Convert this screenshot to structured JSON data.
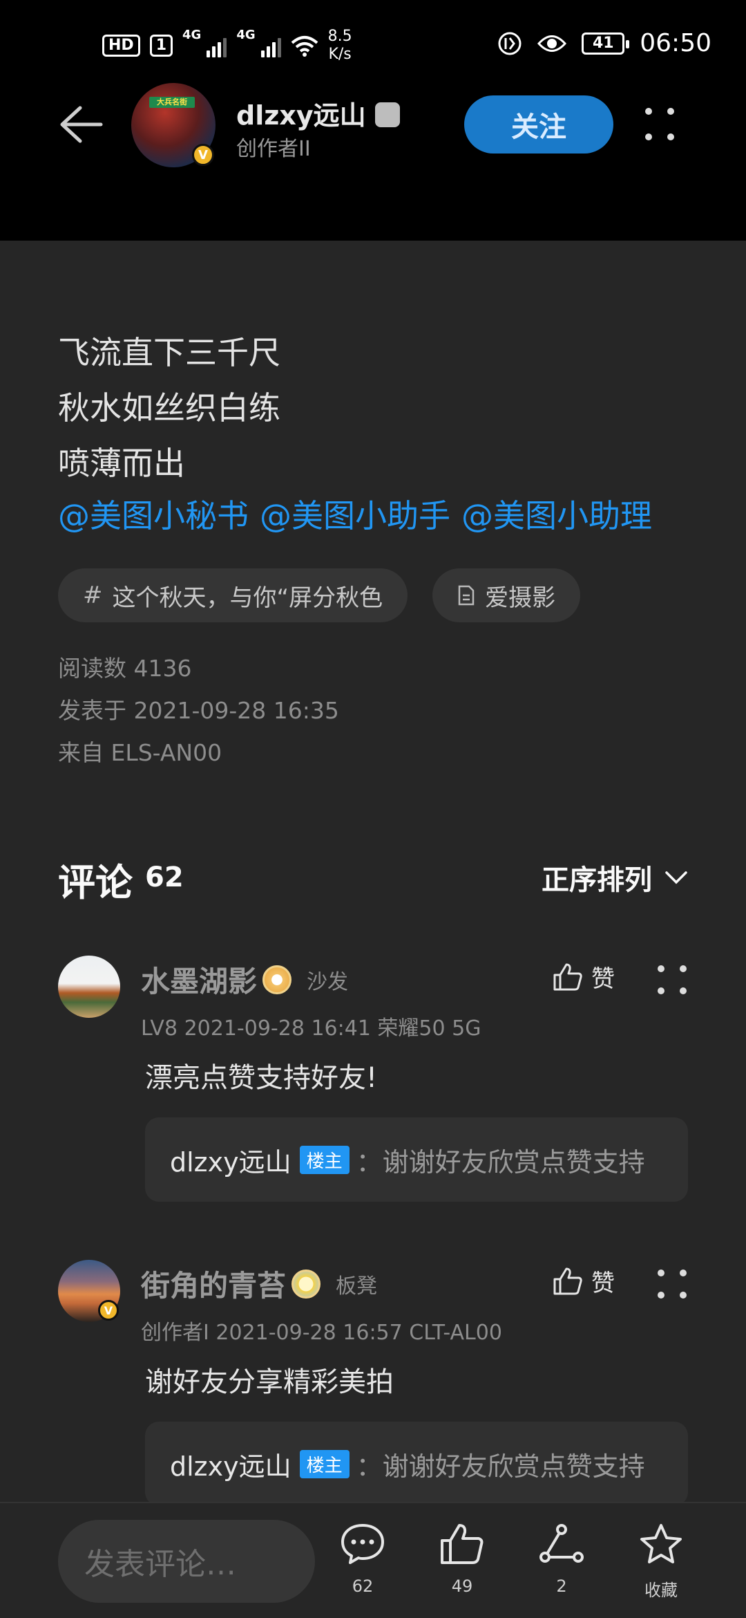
{
  "status_bar": {
    "hd": "HD",
    "sim": "1",
    "net1": "4G",
    "net2": "4G",
    "speed_value": "8.5",
    "speed_unit": "K/s",
    "battery": "41",
    "time": "06:50"
  },
  "header": {
    "author_name": "dlzxy远山",
    "author_role": "创作者II",
    "avatar_sign": "大兵名街",
    "follow_label": "关注"
  },
  "post": {
    "lines": [
      "飞流直下三千尺",
      "秋水如丝织白练",
      "喷薄而出"
    ],
    "mentions": [
      "@美图小秘书",
      "@美图小助手",
      "@美图小助理"
    ],
    "tags": [
      {
        "icon": "hashtag-icon",
        "label": "这个秋天，与你“屏分秋色"
      },
      {
        "icon": "document-icon",
        "label": "爱摄影"
      }
    ],
    "read_count": "阅读数 4136",
    "posted_at": "发表于 2021-09-28 16:35",
    "device": "来自 ELS-AN00"
  },
  "comments_header": {
    "title": "评论",
    "count": "62",
    "sort_label": "正序排列"
  },
  "comments": [
    {
      "name": "水墨湖影",
      "badge": "沙发",
      "meta": "LV8   2021-09-28 16:41   荣耀50 5G",
      "like_label": "赞",
      "text": "漂亮点赞支持好友!",
      "reply": {
        "name": "dlzxy远山",
        "owner_tag": "楼主",
        "text": "：谢谢好友欣赏点赞支持"
      }
    },
    {
      "name": "街角的青苔",
      "badge": "板凳",
      "meta": "创作者I   2021-09-28 16:57   CLT-AL00",
      "like_label": "赞",
      "text": "谢好友分享精彩美拍",
      "reply": {
        "name": "dlzxy远山",
        "owner_tag": "楼主",
        "text": "：谢谢好友欣赏点赞支持"
      }
    }
  ],
  "bottom_bar": {
    "input_placeholder": "发表评论…",
    "comment_count": "62",
    "like_count": "49",
    "share_count": "2",
    "favorite_label": "收藏"
  },
  "colors": {
    "accent": "#2196f3",
    "follow_button": "#1a7ac9",
    "background": "#262626",
    "header_background": "#000000"
  }
}
